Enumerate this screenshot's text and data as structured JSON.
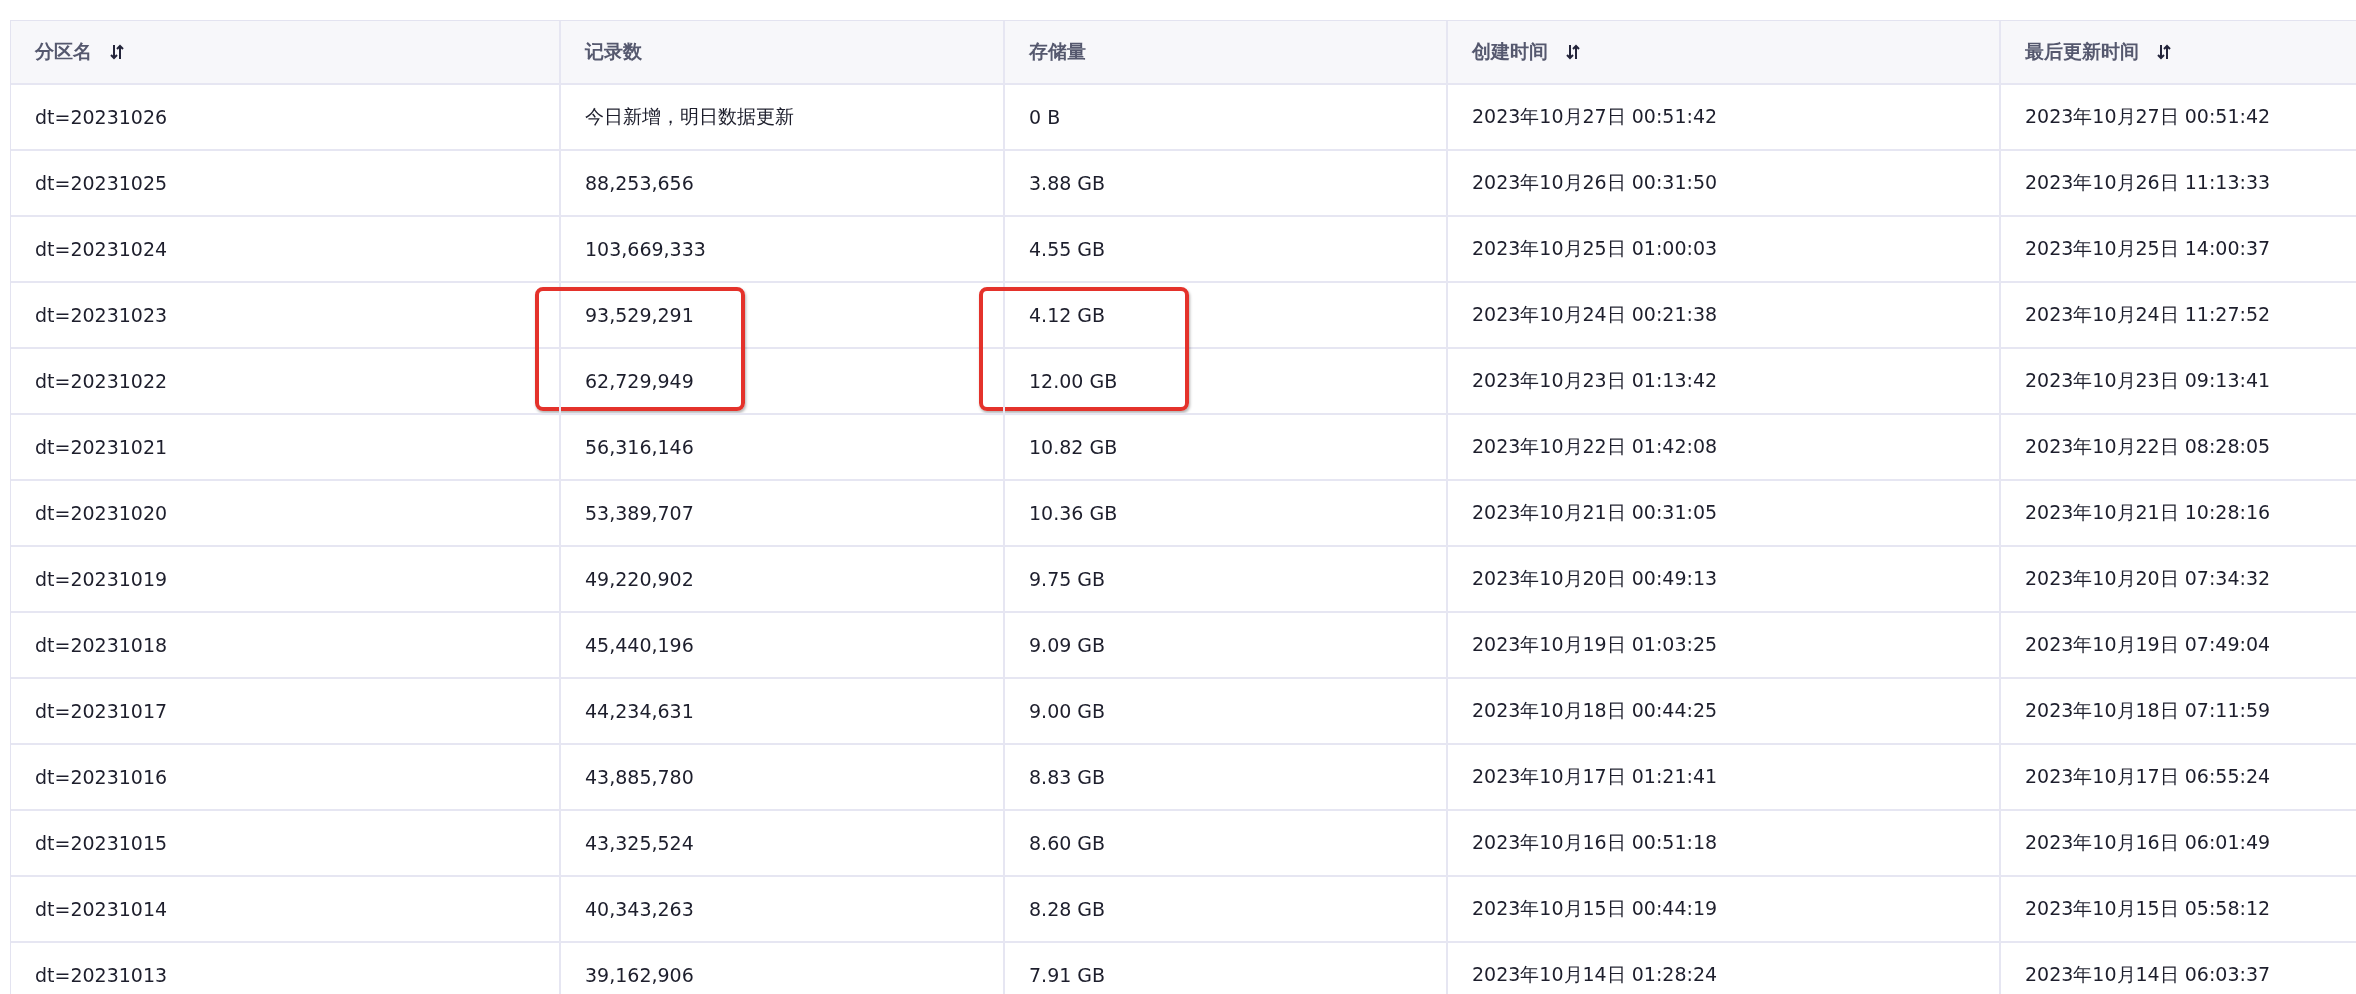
{
  "columns": [
    {
      "label": "分区名",
      "sortable": true,
      "marked": false
    },
    {
      "label": "记录数",
      "sortable": false,
      "marked": true
    },
    {
      "label": "存储量",
      "sortable": false,
      "marked": true
    },
    {
      "label": "创建时间",
      "sortable": true,
      "marked": false
    },
    {
      "label": "最后更新时间",
      "sortable": true,
      "marked": false
    }
  ],
  "rows": [
    {
      "marked": false,
      "cells": [
        "dt=20231026",
        "今日新增，明日数据更新",
        "0 B",
        "2023年10月27日 00:51:42",
        "2023年10月27日 00:51:42"
      ]
    },
    {
      "marked": false,
      "cells": [
        "dt=20231025",
        "88,253,656",
        "3.88 GB",
        "2023年10月26日 00:31:50",
        "2023年10月26日 11:13:33"
      ]
    },
    {
      "marked": false,
      "cells": [
        "dt=20231024",
        "103,669,333",
        "4.55 GB",
        "2023年10月25日 01:00:03",
        "2023年10月25日 14:00:37"
      ]
    },
    {
      "marked": true,
      "cells": [
        "dt=20231023",
        "93,529,291",
        "4.12 GB",
        "2023年10月24日 00:21:38",
        "2023年10月24日 11:27:52"
      ]
    },
    {
      "marked": true,
      "cells": [
        "dt=20231022",
        "62,729,949",
        "12.00 GB",
        "2023年10月23日 01:13:42",
        "2023年10月23日 09:13:41"
      ]
    },
    {
      "marked": false,
      "cells": [
        "dt=20231021",
        "56,316,146",
        "10.82 GB",
        "2023年10月22日 01:42:08",
        "2023年10月22日 08:28:05"
      ]
    },
    {
      "marked": false,
      "cells": [
        "dt=20231020",
        "53,389,707",
        "10.36 GB",
        "2023年10月21日 00:31:05",
        "2023年10月21日 10:28:16"
      ]
    },
    {
      "marked": false,
      "cells": [
        "dt=20231019",
        "49,220,902",
        "9.75 GB",
        "2023年10月20日 00:49:13",
        "2023年10月20日 07:34:32"
      ]
    },
    {
      "marked": false,
      "cells": [
        "dt=20231018",
        "45,440,196",
        "9.09 GB",
        "2023年10月19日 01:03:25",
        "2023年10月19日 07:49:04"
      ]
    },
    {
      "marked": false,
      "cells": [
        "dt=20231017",
        "44,234,631",
        "9.00 GB",
        "2023年10月18日 00:44:25",
        "2023年10月18日 07:11:59"
      ]
    },
    {
      "marked": false,
      "cells": [
        "dt=20231016",
        "43,885,780",
        "8.83 GB",
        "2023年10月17日 01:21:41",
        "2023年10月17日 06:55:24"
      ]
    },
    {
      "marked": false,
      "cells": [
        "dt=20231015",
        "43,325,524",
        "8.60 GB",
        "2023年10月16日 00:51:18",
        "2023年10月16日 06:01:49"
      ]
    },
    {
      "marked": false,
      "cells": [
        "dt=20231014",
        "40,343,263",
        "8.28 GB",
        "2023年10月15日 00:44:19",
        "2023年10月15日 05:58:12"
      ]
    },
    {
      "marked": false,
      "cells": [
        "dt=20231013",
        "39,162,906",
        "7.91 GB",
        "2023年10月14日 01:28:24",
        "2023年10月14日 06:03:37"
      ]
    }
  ]
}
